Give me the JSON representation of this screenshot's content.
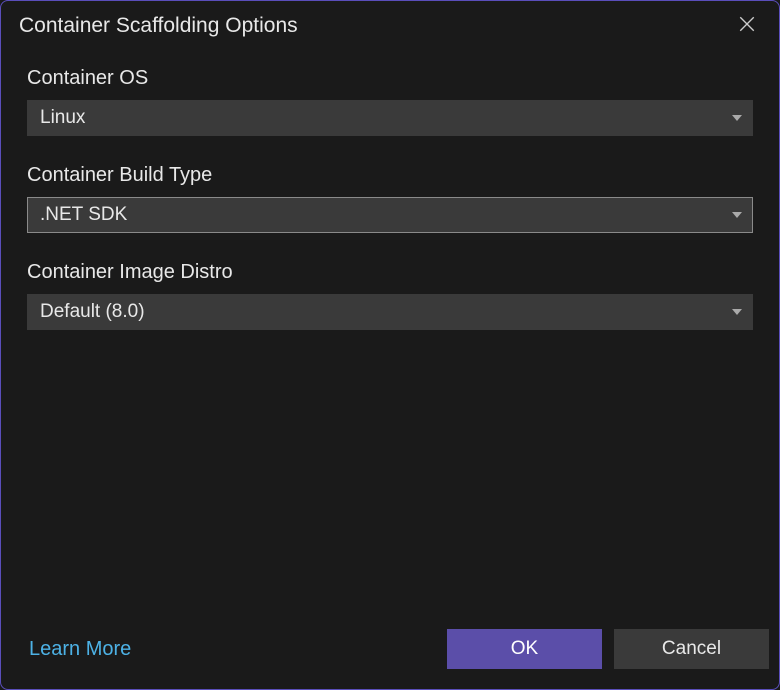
{
  "dialog": {
    "title": "Container Scaffolding Options"
  },
  "fields": {
    "os": {
      "label": "Container OS",
      "value": "Linux"
    },
    "buildType": {
      "label": "Container Build Type",
      "value": ".NET SDK"
    },
    "imageDistro": {
      "label": "Container Image Distro",
      "value": "Default (8.0)"
    }
  },
  "footer": {
    "learnMore": "Learn More",
    "ok": "OK",
    "cancel": "Cancel"
  }
}
